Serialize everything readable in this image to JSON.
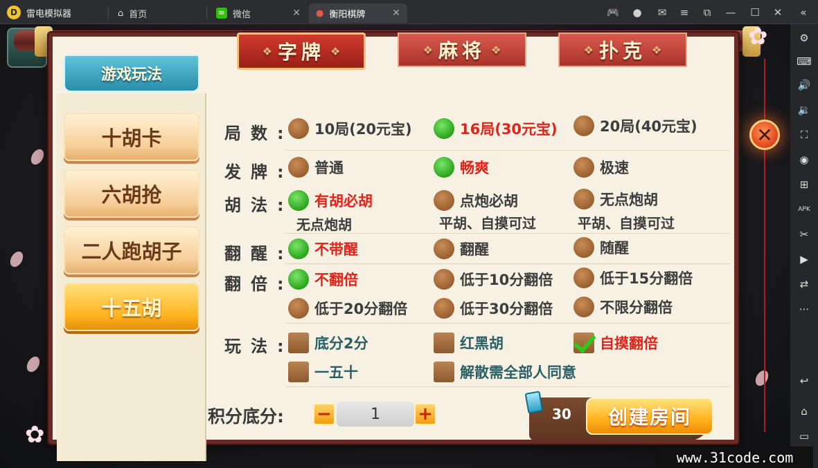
{
  "emulator": {
    "app_name": "雷电模拟器",
    "tabs": [
      {
        "label": "首页",
        "icon": "home-icon"
      },
      {
        "label": "微信",
        "icon": "wechat-icon"
      },
      {
        "label": "衡阳棋牌",
        "icon": "app-icon"
      }
    ],
    "window_icons": [
      "gamepad-icon",
      "user-icon",
      "mail-icon",
      "menu-icon",
      "restore-icon",
      "minimize-icon",
      "maximize-icon",
      "close-icon",
      "collapse-icon"
    ],
    "side_icons": [
      "settings-icon",
      "keyboard-icon",
      "volume-up-icon",
      "volume-down-icon",
      "screenshot-icon",
      "record-icon",
      "add-app-icon",
      "apk-icon",
      "scissors-icon",
      "video-icon",
      "sync-icon",
      "more-icon",
      "back-icon",
      "home-nav-icon",
      "recent-icon"
    ]
  },
  "game": {
    "panel_title": "游戏玩法",
    "category_tabs": [
      "字牌",
      "麻将",
      "扑克"
    ],
    "modes": [
      {
        "label": "十胡卡",
        "active": false
      },
      {
        "label": "六胡抢",
        "active": false
      },
      {
        "label": "二人跑胡子",
        "active": false
      },
      {
        "label": "十五胡",
        "active": true
      }
    ],
    "rules": {
      "rounds": {
        "label": "局数",
        "options": [
          "10局(20元宝)",
          "16局(30元宝)",
          "20局(40元宝)"
        ],
        "selected": 1
      },
      "deal": {
        "label": "发牌",
        "options": [
          "普通",
          "畅爽",
          "极速"
        ],
        "selected": 1
      },
      "hu": {
        "label": "胡法",
        "options": [
          "有胡必胡",
          "点炮必胡",
          "无点炮胡"
        ],
        "notes": [
          "无点炮胡",
          "平胡、自摸可过",
          "平胡、自摸可过"
        ],
        "selected": 0
      },
      "xing": {
        "label": "翻醒",
        "options": [
          "不带醒",
          "翻醒",
          "随醒"
        ],
        "selected": 0
      },
      "double": {
        "label": "翻倍",
        "options": [
          "不翻倍",
          "低于10分翻倍",
          "低于15分翻倍",
          "低于20分翻倍",
          "低于30分翻倍",
          "不限分翻倍"
        ],
        "selected": 0
      },
      "play": {
        "label": "玩法",
        "options": [
          "底分2分",
          "红黑胡",
          "自摸翻倍",
          "一五十",
          "解散需全部人同意"
        ],
        "checked": [
          2
        ]
      }
    },
    "score": {
      "label": "积分底分:",
      "value": "1",
      "minus": "−",
      "plus": "+"
    },
    "cost": "30",
    "create_button": "创建房间",
    "close_symbol": "✕"
  },
  "watermark": "www.31code.com",
  "colors": {
    "selected_text": "#e2231a",
    "accent": "#ffb21c",
    "teal": "#2b5f66"
  }
}
